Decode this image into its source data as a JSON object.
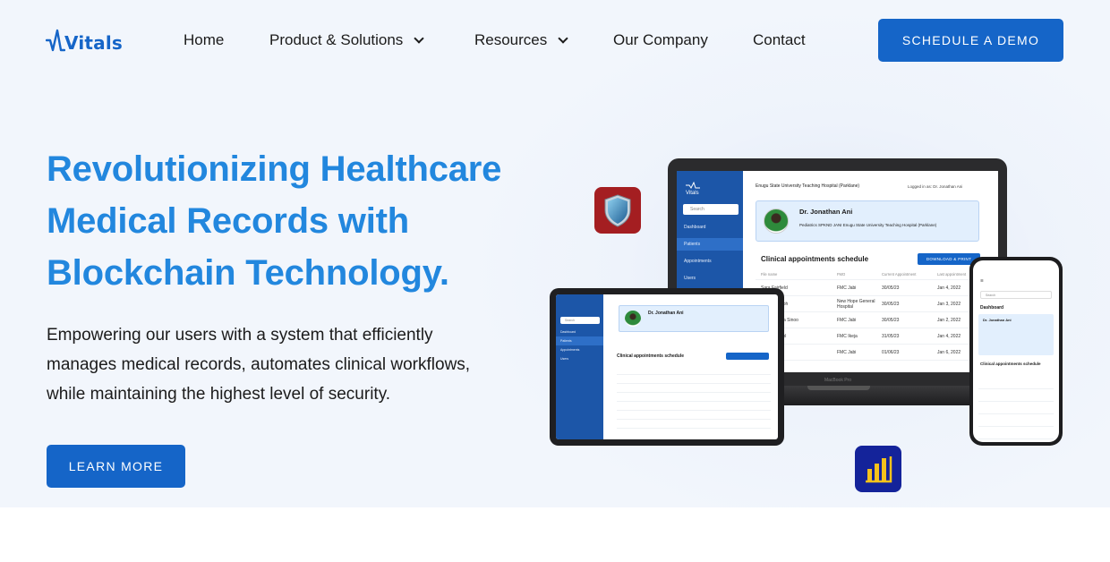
{
  "brand": {
    "name": "Vitals",
    "logo_text": "Vitals",
    "color": "#1565c8"
  },
  "nav": {
    "items": [
      {
        "label": "Home",
        "has_dropdown": false
      },
      {
        "label": "Product & Solutions",
        "has_dropdown": true
      },
      {
        "label": "Resources",
        "has_dropdown": true
      },
      {
        "label": "Our Company",
        "has_dropdown": false
      },
      {
        "label": "Contact",
        "has_dropdown": false
      }
    ],
    "cta_label": "SCHEDULE A DEMO"
  },
  "hero": {
    "headline_lines": [
      "Revolutionizing Healthcare",
      "Medical Records with",
      "Blockchain Technology."
    ],
    "subtext_lines": [
      "Empowering our users with a system that efficiently",
      "manages medical records, automates clinical workflows,",
      "while maintaining the highest level of security."
    ],
    "cta_label": "LEARN MORE"
  },
  "mockup": {
    "sidebar_logo": "Vitals",
    "search_placeholder": "Search",
    "sidebar_items": [
      "Dashboard",
      "Patients",
      "Appointments",
      "Users"
    ],
    "hospital": "Enugu State University Teaching Hospital (Parklane)",
    "logged_in": "Logged in as: Dr. Jonathan Ani",
    "doctor_name": "Dr. Jonathan Ani",
    "doctor_meta": "Pediatrics   SPKND JANI   Enugu State University Teaching Hospital (Parklane)",
    "section_title": "Clinical appointments schedule",
    "download_label": "DOWNLOAD & PRINT",
    "table_headers": [
      "File name",
      "FMO",
      "Current Appointment",
      "Last appointment"
    ],
    "table_rows": [
      [
        "Sara Fairfield",
        "FMC Jabi",
        "30/05/23",
        "Jan 4, 2022"
      ],
      [
        "Chioma Uzoh",
        "New Hope General Hospital",
        "30/05/23",
        "Jan 3, 2022"
      ],
      [
        "Emmanuella Sinoo",
        "FMC Jabi",
        "30/05/23",
        "Jan 2, 2022"
      ],
      [
        "Abuh Simbol",
        "FMC Ikeja",
        "31/05/23",
        "Jan 4, 2022"
      ],
      [
        "Ozoh Bah",
        "FMC Jabi",
        "01/06/23",
        "Jan 6, 2022"
      ]
    ],
    "laptop_label": "MacBook Pro",
    "phone_dashboard": "Dashboard"
  },
  "icons": [
    "shield-icon",
    "analytics-chart-icon"
  ]
}
